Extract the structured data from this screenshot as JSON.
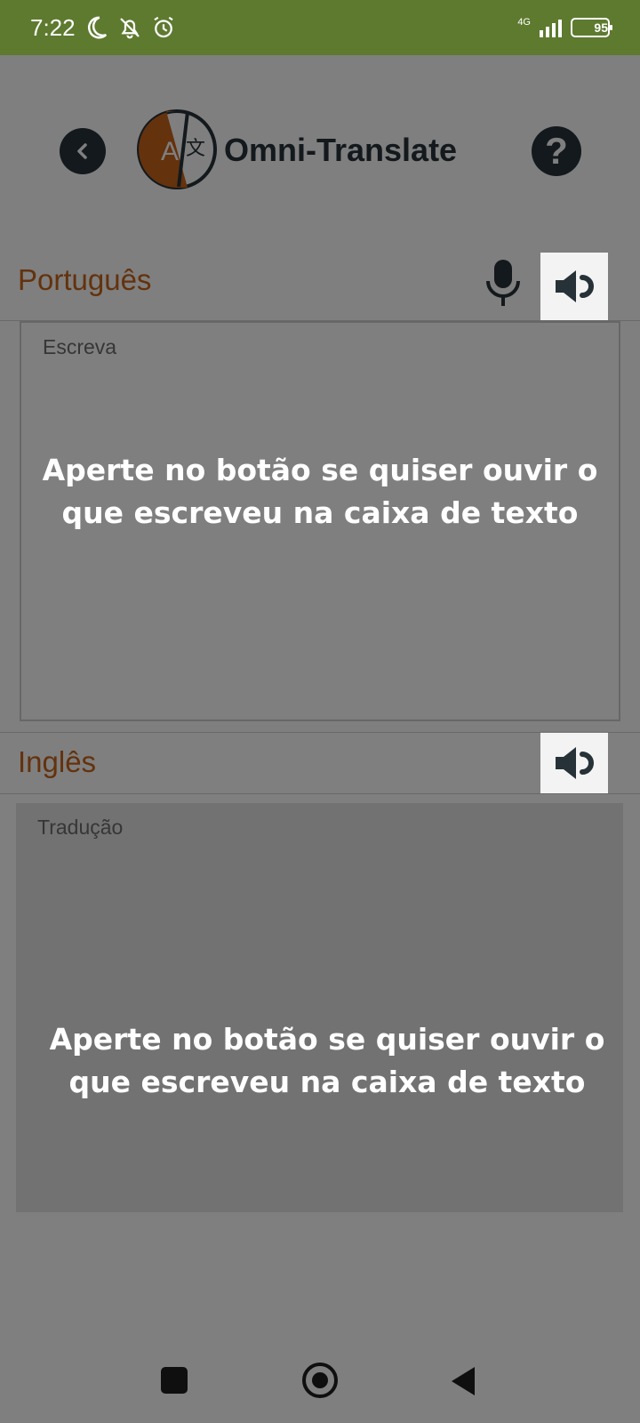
{
  "status_bar": {
    "time": "7:22",
    "network": "4G",
    "battery": "95",
    "battery_level_percent": 95
  },
  "header": {
    "app_title": "Omni-Translate",
    "back_icon": "chevron-left-icon",
    "help_icon": "help-circle-icon",
    "logo_icon": "translate-icon"
  },
  "source": {
    "language": "Português",
    "placeholder": "Escreva"
  },
  "target": {
    "language": "Inglês",
    "placeholder": "Tradução"
  },
  "tutorial": {
    "hint_1": "Aperte no botão se quiser ouvir o que escreveu na caixa de texto",
    "hint_2": "Aperte no botão se quiser ouvir o que escreveu na caixa de texto"
  },
  "colors": {
    "accent": "#c8641a",
    "dark": "#263238",
    "status_bar": "#5d7a2f"
  }
}
